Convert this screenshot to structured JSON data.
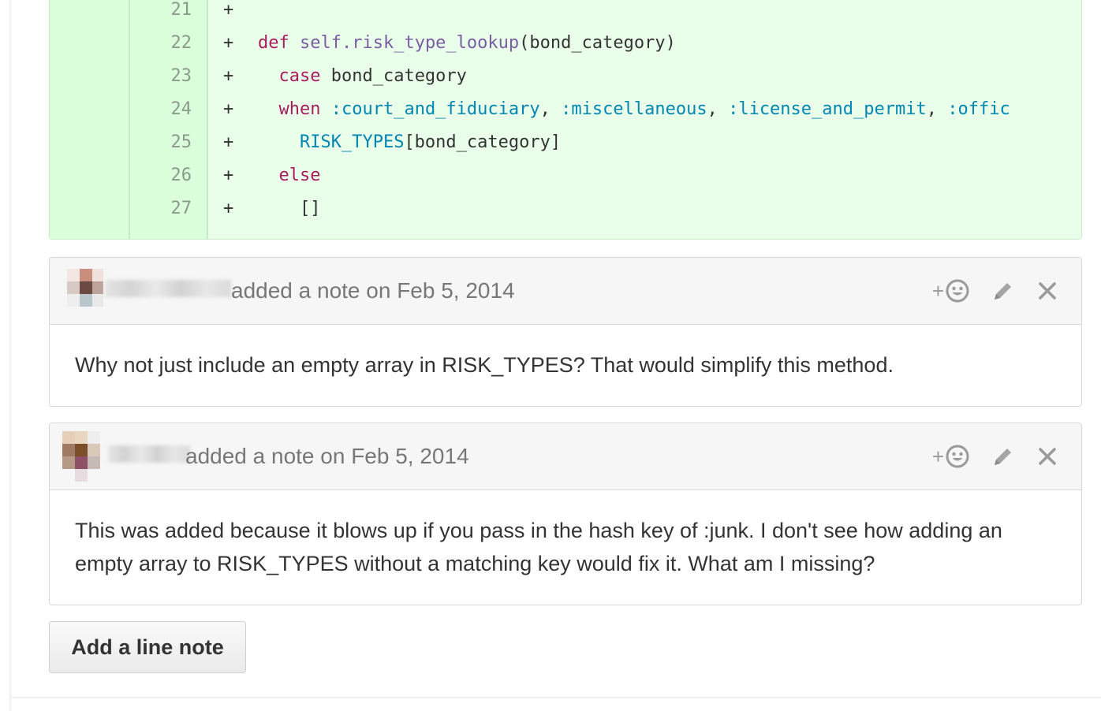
{
  "diff": {
    "lines": [
      {
        "num": "21",
        "marker": "+"
      },
      {
        "num": "22",
        "marker": "+"
      },
      {
        "num": "23",
        "marker": "+"
      },
      {
        "num": "24",
        "marker": "+"
      },
      {
        "num": "25",
        "marker": "+"
      },
      {
        "num": "26",
        "marker": "+"
      },
      {
        "num": "27",
        "marker": "+"
      }
    ],
    "code": {
      "l22_kw": "def",
      "l22_fn": "self.risk_type_lookup",
      "l22_rest": "(bond_category)",
      "l23_kw": "case",
      "l23_rest": " bond_category",
      "l24_kw": "when",
      "l24_s1": ":court_and_fiduciary",
      "l24_c1": ", ",
      "l24_s2": ":miscellaneous",
      "l24_c2": ", ",
      "l24_s3": ":license_and_permit",
      "l24_c3": ", ",
      "l24_s4": ":offic",
      "l25_const": "RISK_TYPES",
      "l25_rest": "[bond_category]",
      "l26_kw": "else",
      "l27": "[]"
    }
  },
  "notes": [
    {
      "meta": "added a note on Feb 5, 2014",
      "body": "Why not just include an empty array in RISK_TYPES? That would simplify this method.",
      "reaction_plus": "+"
    },
    {
      "meta": "added a note on Feb 5, 2014",
      "body": "This was added because it blows up if you pass in the hash key of :junk. I don't see how adding an empty array to RISK_TYPES without a matching key would fix it. What am I missing?",
      "reaction_plus": "+"
    }
  ],
  "add_line_note": "Add a line note",
  "icons": [
    "smiley-icon",
    "pencil-icon",
    "close-icon"
  ],
  "colors": {
    "diff_bg": "#eaffea",
    "keyword": "#a71d5d",
    "function": "#795da3",
    "symbol": "#0086b3"
  }
}
